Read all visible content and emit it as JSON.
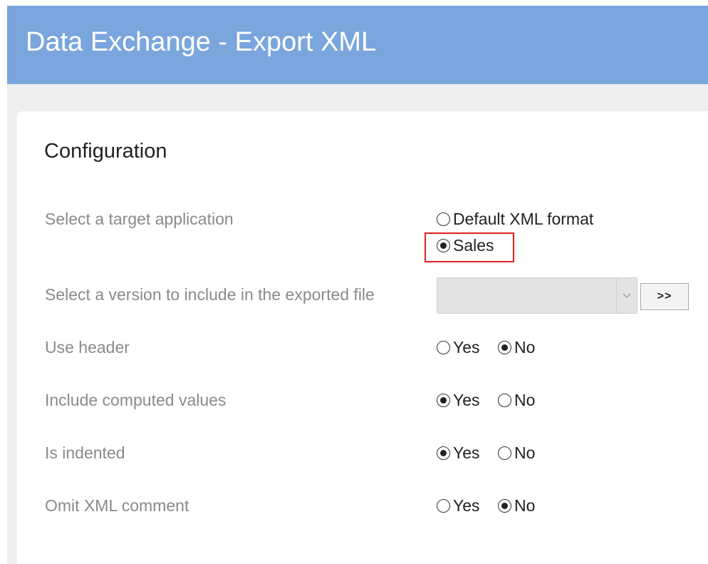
{
  "window": {
    "title": "Data Exchange - Export XML"
  },
  "configuration": {
    "section_title": "Configuration",
    "target_application": {
      "label": "Select a target application",
      "options": [
        "Default XML format",
        "Sales"
      ],
      "selected": "Sales"
    },
    "version": {
      "label": "Select a version to include in the exported file",
      "selected_value": "",
      "go_button_label": ">>"
    },
    "use_header": {
      "label": "Use header",
      "yes_label": "Yes",
      "no_label": "No",
      "selected": "No"
    },
    "include_computed_values": {
      "label": "Include computed values",
      "yes_label": "Yes",
      "no_label": "No",
      "selected": "Yes"
    },
    "is_indented": {
      "label": "Is indented",
      "yes_label": "Yes",
      "no_label": "No",
      "selected": "Yes"
    },
    "omit_xml_comment": {
      "label": "Omit XML comment",
      "yes_label": "Yes",
      "no_label": "No",
      "selected": "No"
    }
  },
  "colors": {
    "title_bar": "#7aa6dd",
    "highlight": "#e02020"
  }
}
